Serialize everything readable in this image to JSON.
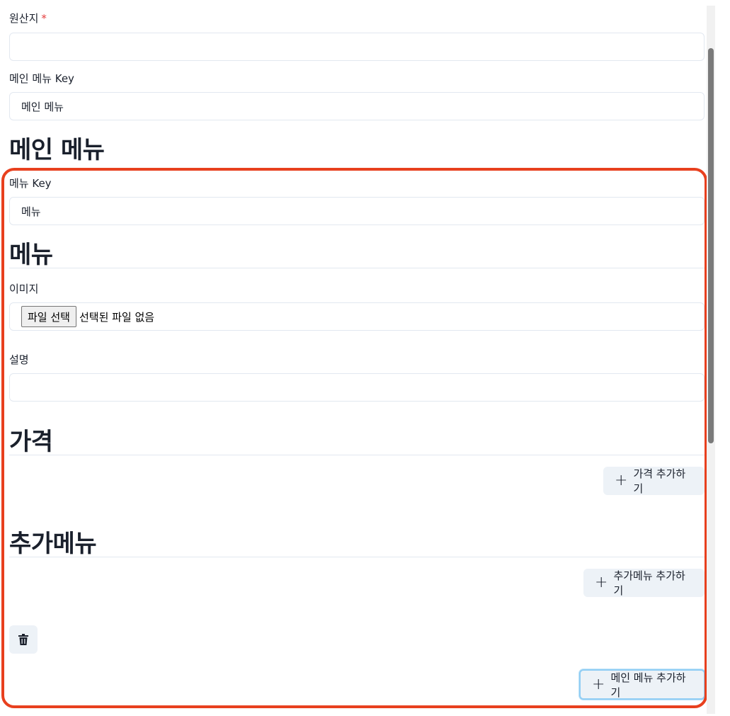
{
  "origin": {
    "label": "원산지",
    "required_mark": "*",
    "value": ""
  },
  "main_menu_key": {
    "label": "메인 메뉴 Key",
    "value": "메인 메뉴"
  },
  "main_menu_heading": "메인 메뉴",
  "menu_group": {
    "menu_key": {
      "label": "메뉴 Key",
      "value": "메뉴"
    },
    "menu_heading": "메뉴",
    "image": {
      "label": "이미지",
      "file_button_label": "파일 선택",
      "file_status": "선택된 파일 없음"
    },
    "description": {
      "label": "설명",
      "value": ""
    },
    "price_heading": "가격",
    "add_price_label": "가격 추가하기",
    "extra_menu_heading": "추가메뉴",
    "add_extra_menu_label": "추가메뉴 추가하기",
    "delete_icon": "trash-icon"
  },
  "add_main_menu_label": "메인 메뉴 추가하기",
  "highlight_color": "#e8401e"
}
